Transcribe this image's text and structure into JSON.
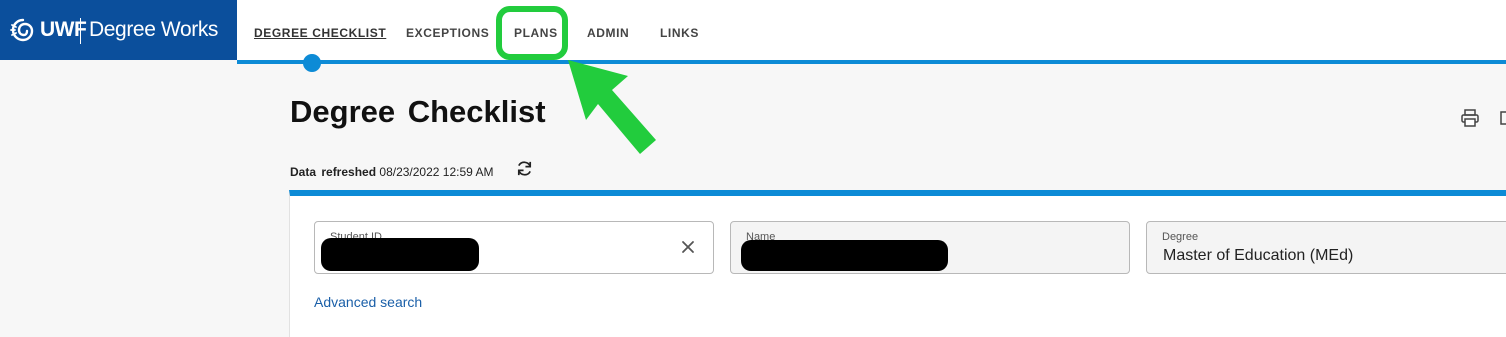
{
  "brand": {
    "short": "UWF",
    "product": "Degree Works"
  },
  "nav": {
    "items": [
      {
        "label": "DEGREE CHECKLIST"
      },
      {
        "label": "EXCEPTIONS"
      },
      {
        "label": "PLANS"
      },
      {
        "label": "ADMIN"
      },
      {
        "label": "LINKS"
      }
    ]
  },
  "page": {
    "title": "Degree Checklist",
    "refresh_label": "Data refreshed",
    "refresh_timestamp": "08/23/2022 12:59 AM"
  },
  "fields": {
    "student_id": {
      "label": "Student ID",
      "value": ""
    },
    "name": {
      "label": "Name",
      "value": ""
    },
    "degree": {
      "label": "Degree",
      "value": "Master of Education (MEd)"
    }
  },
  "links": {
    "advanced_search": "Advanced search"
  },
  "icons": [
    "spiral-logo-icon",
    "print-icon",
    "more-icon",
    "refresh-icon",
    "clear-icon",
    "arrow-pointer-icon"
  ],
  "colors": {
    "brand_blue": "#0b4f9c",
    "accent_blue": "#0d8bd6",
    "highlight_green": "#22cc3d",
    "link_blue": "#1a5fa8"
  }
}
